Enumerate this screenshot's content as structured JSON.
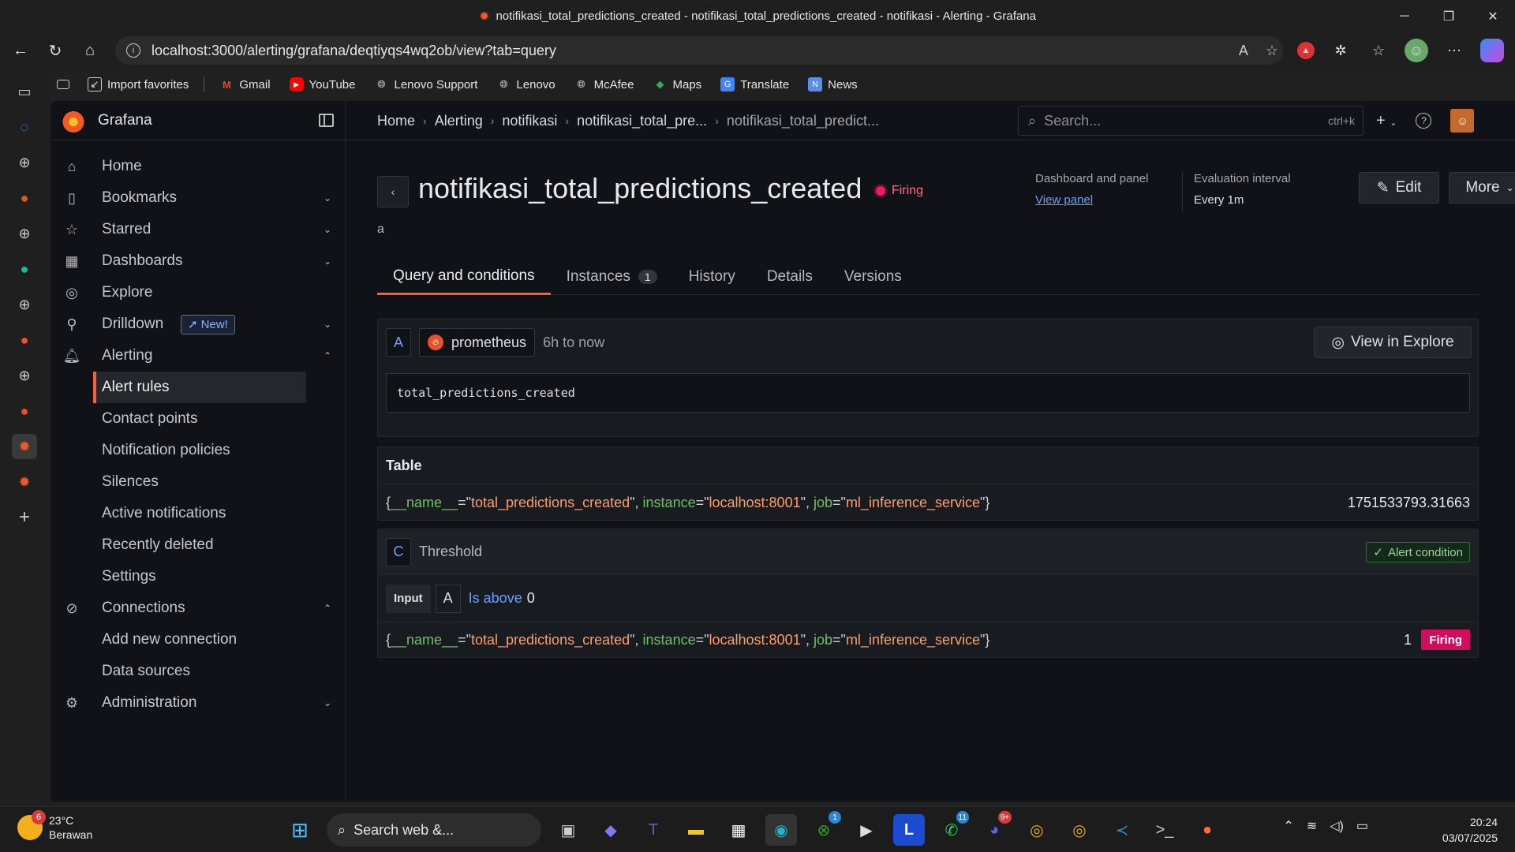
{
  "window": {
    "title": "notifikasi_total_predictions_created - notifikasi_total_predictions_created - notifikasi - Alerting - Grafana"
  },
  "browser": {
    "url": "localhost:3000/alerting/grafana/deqtiyqs4wq2ob/view?tab=query",
    "bookmarks": [
      {
        "label": "Import favorites",
        "icon": "import-icon"
      },
      {
        "label": "Gmail",
        "icon": "gmail-icon"
      },
      {
        "label": "YouTube",
        "icon": "youtube-icon"
      },
      {
        "label": "Lenovo Support",
        "icon": "globe-icon"
      },
      {
        "label": "Lenovo",
        "icon": "globe-icon"
      },
      {
        "label": "McAfee",
        "icon": "globe-icon"
      },
      {
        "label": "Maps",
        "icon": "maps-icon"
      },
      {
        "label": "Translate",
        "icon": "translate-icon"
      },
      {
        "label": "News",
        "icon": "news-icon"
      }
    ]
  },
  "grafana": {
    "brand": "Grafana",
    "breadcrumbs": [
      "Home",
      "Alerting",
      "notifikasi",
      "notifikasi_total_pre...",
      "notifikasi_total_predict..."
    ],
    "search": {
      "placeholder": "Search...",
      "shortcut": "ctrl+k"
    },
    "sidebar": {
      "items": [
        {
          "label": "Home",
          "icon": "home-icon"
        },
        {
          "label": "Bookmarks",
          "icon": "bookmark-icon"
        },
        {
          "label": "Starred",
          "icon": "star-icon"
        },
        {
          "label": "Dashboards",
          "icon": "apps-icon"
        },
        {
          "label": "Explore",
          "icon": "compass-icon"
        },
        {
          "label": "Drilldown",
          "icon": "drilldown-icon",
          "badge": "New!"
        },
        {
          "label": "Alerting",
          "icon": "bell-icon"
        },
        {
          "label": "Connections",
          "icon": "connections-icon"
        },
        {
          "label": "Administration",
          "icon": "gear-icon"
        }
      ],
      "alerting_sub": [
        "Alert rules",
        "Contact points",
        "Notification policies",
        "Silences",
        "Active notifications",
        "Recently deleted",
        "Settings"
      ],
      "connections_sub": [
        "Add new connection",
        "Data sources"
      ]
    },
    "rule": {
      "title": "notifikasi_total_predictions_created",
      "state": "Firing",
      "summary": "a",
      "dashboard_label": "Dashboard and panel",
      "dashboard_link": "View panel",
      "interval_label": "Evaluation interval",
      "interval_value": "Every 1m",
      "edit_label": "Edit",
      "more_label": "More"
    },
    "tabs": [
      {
        "label": "Query and conditions",
        "active": true
      },
      {
        "label": "Instances",
        "count": "1"
      },
      {
        "label": "History"
      },
      {
        "label": "Details"
      },
      {
        "label": "Versions"
      }
    ],
    "query": {
      "ref": "A",
      "datasource": "prometheus",
      "time_range": "6h to now",
      "explore_label": "View in Explore",
      "expression": "total_predictions_created"
    },
    "table": {
      "title": "Table",
      "labels": [
        {
          "key": "__name__",
          "value": "total_predictions_created"
        },
        {
          "key": "instance",
          "value": "localhost:8001"
        },
        {
          "key": "job",
          "value": "ml_inference_service"
        }
      ],
      "value": "1751533793.31663"
    },
    "threshold": {
      "ref": "C",
      "name": "Threshold",
      "condition_label": "Alert condition",
      "input_label": "Input",
      "input_ref": "A",
      "operator": "Is above",
      "threshold_value": "0",
      "result_value": "1",
      "result_state": "Firing"
    }
  },
  "taskbar": {
    "weather_temp": "23°C",
    "weather_desc": "Berawan",
    "weather_badge": "6",
    "search_label": "Search web &...",
    "xbox_badge": "1",
    "whatsapp_badge": "11",
    "discord_badge": "9+",
    "time": "20:24",
    "date": "03/07/2025"
  },
  "colors": {
    "accent": "#f55f3e",
    "firing": "#d10e5c",
    "link": "#6e9fff",
    "label_key": "#73bf69",
    "label_value": "#ff9d6b"
  }
}
